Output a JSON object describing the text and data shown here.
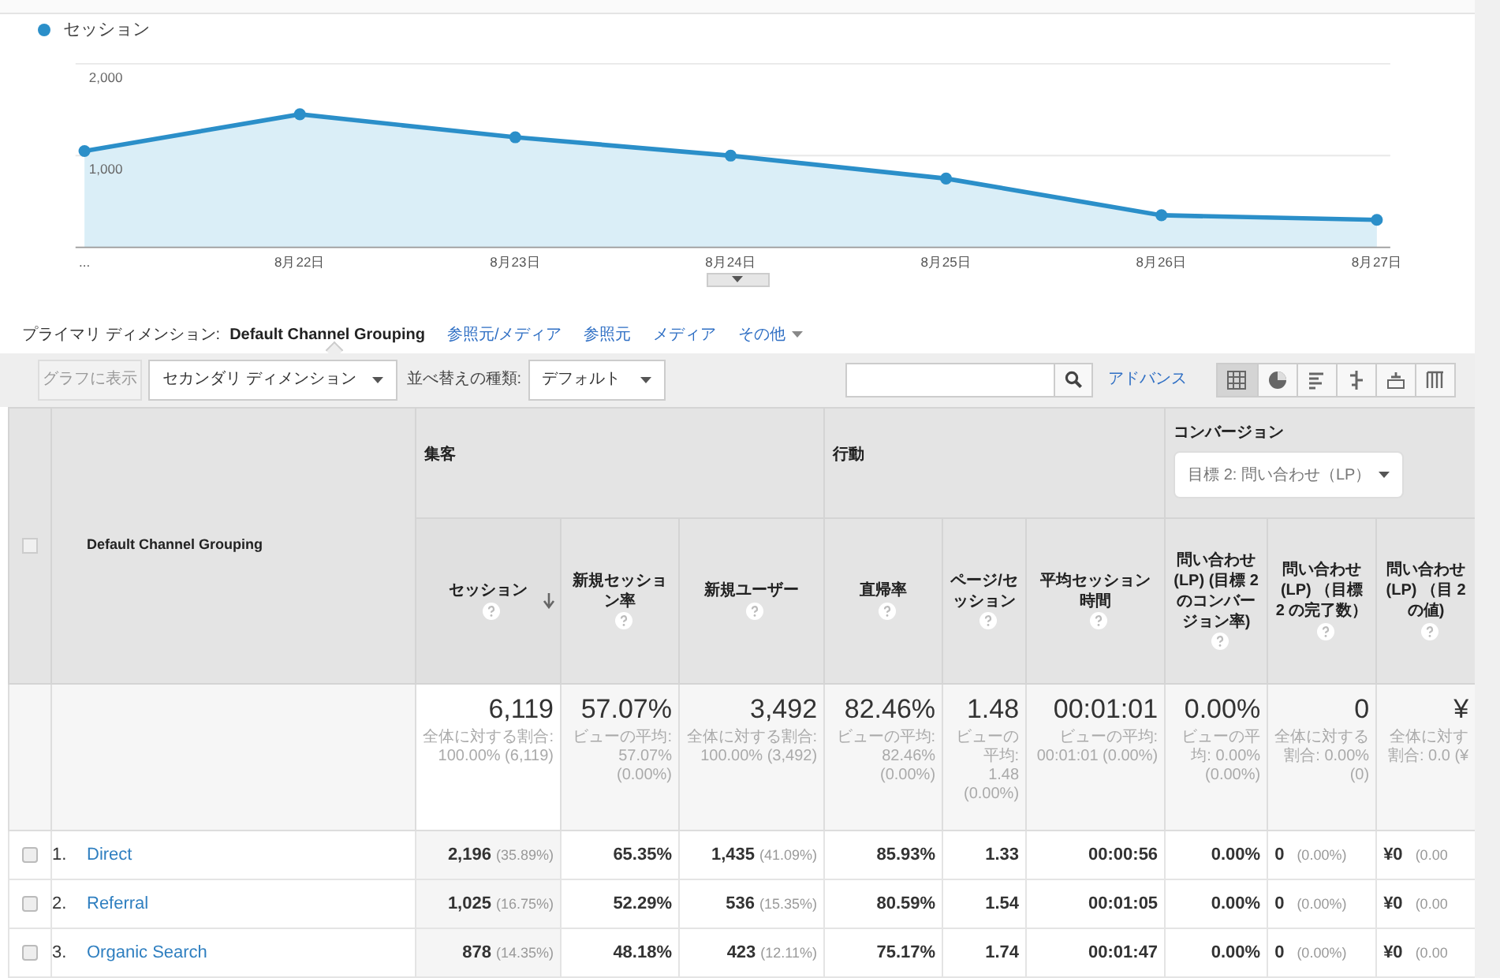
{
  "chart": {
    "chart_data": {
      "type": "area",
      "categories": [
        "...",
        "8月22日",
        "8月23日",
        "8月24日",
        "8月25日",
        "8月26日",
        "8月27日"
      ],
      "ylim": [
        0,
        2000
      ],
      "yticks": [
        {
          "value": 1000,
          "label": "1,000"
        },
        {
          "value": 2000,
          "label": "2,000"
        }
      ],
      "series": [
        {
          "name": "セッション",
          "color": "#2b8fc9",
          "values": [
            1050,
            1450,
            1200,
            1000,
            750,
            350,
            300
          ]
        }
      ]
    }
  },
  "primary_dimension": {
    "label": "プライマリ ディメンション:",
    "options": [
      {
        "label": "Default Channel Grouping",
        "selected": true,
        "menu": false
      },
      {
        "label": "参照元/メディア",
        "selected": false,
        "menu": false
      },
      {
        "label": "参照元",
        "selected": false,
        "menu": false
      },
      {
        "label": "メディア",
        "selected": false,
        "menu": false
      },
      {
        "label": "その他",
        "selected": false,
        "menu": true
      }
    ]
  },
  "toolbar": {
    "plot_button": {
      "label": "グラフに表示",
      "disabled": true
    },
    "secondary_dimension": "セカンダリ ディメンション",
    "sort_label": "並べ替えの種類:",
    "sort_value": "デフォルト",
    "advanced": "アドバンス",
    "views": [
      {
        "kind": "table",
        "selected": true
      },
      {
        "kind": "pie",
        "selected": false
      },
      {
        "kind": "bars",
        "selected": false
      },
      {
        "kind": "compare",
        "selected": false
      },
      {
        "kind": "pivot",
        "selected": false
      },
      {
        "kind": "columns",
        "selected": false
      }
    ]
  },
  "table": {
    "all_checked": false,
    "dimension": "Default Channel Grouping",
    "groups": [
      {
        "title": "集客",
        "columns": [
          {
            "label": "セッション",
            "sorted": true
          },
          {
            "label": "新規セッション率",
            "sorted": false
          },
          {
            "label": "新規ユーザー",
            "sorted": false
          }
        ]
      },
      {
        "title": "行動",
        "columns": [
          {
            "label": "直帰率",
            "sorted": false
          },
          {
            "label": "ページ/セッション",
            "sorted": false
          },
          {
            "label": "平均セッション時間",
            "sorted": false
          }
        ]
      },
      {
        "title": "コンバージョン",
        "goal": "目標 2: 問い合わせ（LP）",
        "columns": [
          {
            "label": "問い合わせ (LP) (目標 2 のコンバージョン率)",
            "sorted": false
          },
          {
            "label": "問い合わせ (LP) （目標 2 の完了数）",
            "sorted": false
          },
          {
            "label": "問い合わせ (LP) （目 2 の値)",
            "sorted": false
          }
        ]
      }
    ],
    "totals": [
      {
        "value": "6,119",
        "note": "全体に対する割合: 100.00% (6,119)"
      },
      {
        "value": "57.07%",
        "note": "ビューの平均: 57.07% (0.00%)"
      },
      {
        "value": "3,492",
        "note": "全体に対する割合: 100.00% (3,492)"
      },
      {
        "value": "82.46%",
        "note": "ビューの平均: 82.46% (0.00%)"
      },
      {
        "value": "1.48",
        "note": "ビューの平均: 1.48 (0.00%)"
      },
      {
        "value": "00:01:01",
        "note": "ビューの平均: 00:01:01 (0.00%)"
      },
      {
        "value": "0.00%",
        "note": "ビューの平均: 0.00% (0.00%)"
      },
      {
        "value": "0",
        "note": "全体に対する割合: 0.00% (0)"
      },
      {
        "value": "¥",
        "note": "全体に対す割合: 0.0 (¥"
      }
    ],
    "rows": [
      {
        "index": "1.",
        "name": "Direct",
        "checked": false,
        "cells": [
          {
            "value": "2,196",
            "share": "(35.89%)"
          },
          {
            "value": "65.35%"
          },
          {
            "value": "1,435",
            "share": "(41.09%)"
          },
          {
            "value": "85.93%"
          },
          {
            "value": "1.33"
          },
          {
            "value": "00:00:56"
          },
          {
            "value": "0.00%"
          },
          {
            "value": "0",
            "share": "(0.00%)"
          },
          {
            "value": "¥0",
            "share": "(0.00"
          }
        ]
      },
      {
        "index": "2.",
        "name": "Referral",
        "checked": false,
        "cells": [
          {
            "value": "1,025",
            "share": "(16.75%)"
          },
          {
            "value": "52.29%"
          },
          {
            "value": "536",
            "share": "(15.35%)"
          },
          {
            "value": "80.59%"
          },
          {
            "value": "1.54"
          },
          {
            "value": "00:01:05"
          },
          {
            "value": "0.00%"
          },
          {
            "value": "0",
            "share": "(0.00%)"
          },
          {
            "value": "¥0",
            "share": "(0.00"
          }
        ]
      },
      {
        "index": "3.",
        "name": "Organic Search",
        "checked": false,
        "cells": [
          {
            "value": "878",
            "share": "(14.35%)"
          },
          {
            "value": "48.18%"
          },
          {
            "value": "423",
            "share": "(12.11%)"
          },
          {
            "value": "75.17%"
          },
          {
            "value": "1.74"
          },
          {
            "value": "00:01:47"
          },
          {
            "value": "0.00%"
          },
          {
            "value": "0",
            "share": "(0.00%)"
          },
          {
            "value": "¥0",
            "share": "(0.00"
          }
        ]
      }
    ]
  }
}
